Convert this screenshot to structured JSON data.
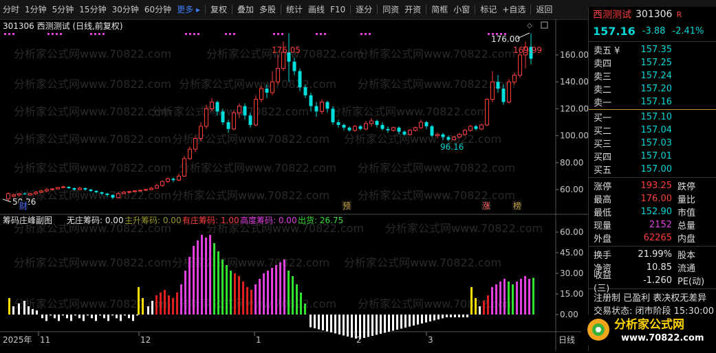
{
  "toolbar": {
    "items": [
      "分时",
      "1分钟",
      "5分钟",
      "15分钟",
      "30分钟",
      "60分钟",
      "更多",
      "复权",
      "叠加",
      "多股",
      "统计",
      "画线",
      "F10",
      "逐分",
      "同资",
      "开资",
      "简框",
      "小窗",
      "标记",
      "+自选",
      "返回"
    ]
  },
  "chart": {
    "title": "301306 西测测试 (日线,前复权)",
    "watermark": "分析家公式网www.70822.com",
    "price_ticks": [
      "160.00",
      "140.00",
      "120.00",
      "100.00",
      "80.00",
      "60.00"
    ],
    "high_label": "176.05",
    "low_label": "96.16",
    "start_label": "50.26",
    "top_right_label": "176.00",
    "last_label": "169.99",
    "markers": {
      "cai": "财",
      "yu": "预",
      "zhang": "涨",
      "bang": "榜"
    },
    "x_labels": [
      "2025年",
      "11",
      "12",
      "1",
      "2",
      "3"
    ],
    "x_right": "日线"
  },
  "indicator": {
    "name": "筹码庄峰副图",
    "items": [
      {
        "label": "无庄筹码: 0.00",
        "color": "#e8e8e8"
      },
      {
        "label": "主升筹码: 0.00",
        "color": "#9a9a2a"
      },
      {
        "label": "有庄筹码: 1.00",
        "color": "#ff3e3e"
      },
      {
        "label": "高度筹码: 0.00",
        "color": "#e040e0"
      },
      {
        "label": "出货: 26.75",
        "color": "#32e032"
      }
    ],
    "ticks": [
      "60.00",
      "45.00",
      "30.00",
      "15.00",
      "0.00"
    ]
  },
  "quote": {
    "name": "西测测试",
    "code": "301306",
    "badge": "R",
    "price": "157.16",
    "change": "-3.88",
    "pct": "-2.41%",
    "asks": [
      {
        "label": "卖五 ¥",
        "price": "157.35"
      },
      {
        "label": "卖四",
        "price": "157.25"
      },
      {
        "label": "卖三",
        "price": "157.24"
      },
      {
        "label": "卖二",
        "price": "157.20"
      },
      {
        "label": "卖一",
        "price": "157.16"
      }
    ],
    "bids": [
      {
        "label": "买一",
        "price": "157.10"
      },
      {
        "label": "买二",
        "price": "157.04"
      },
      {
        "label": "买三",
        "price": "157.03"
      },
      {
        "label": "买四",
        "price": "157.01"
      },
      {
        "label": "买五",
        "price": "157.00"
      }
    ],
    "stats": [
      {
        "k": "涨停",
        "v": "193.25",
        "vc": "red",
        "k2": "跌停",
        "v2": ""
      },
      {
        "k": "最高",
        "v": "176.00",
        "vc": "red",
        "k2": "量比",
        "v2": ""
      },
      {
        "k": "最低",
        "v": "152.90",
        "vc": "cyan",
        "k2": "市值",
        "v2": ""
      },
      {
        "k": "现量",
        "v": "2152",
        "vc": "mag",
        "k2": "总量",
        "v2": ""
      },
      {
        "k": "外盘",
        "v": "62265",
        "vc": "red",
        "k2": "内盘",
        "v2": ""
      }
    ],
    "stats2": [
      {
        "k": "换手",
        "v": "21.99%",
        "k2": "股本",
        "v2": ""
      },
      {
        "k": "净资",
        "v": "10.85",
        "k2": "流通",
        "v2": ""
      },
      {
        "k": "收益(三)",
        "v": "-1.260",
        "k2": "PE(动)",
        "v2": ""
      }
    ],
    "info1": "注册制 已盈利 表决权无差异",
    "info2": "交易状态: 闭市阶段 15:30:00",
    "logo_text": "分析家公式网",
    "logo_url": "www.70822.com"
  },
  "colors": {
    "up": "#ff3e3e",
    "down": "#00dede",
    "bg": "#000000"
  }
}
